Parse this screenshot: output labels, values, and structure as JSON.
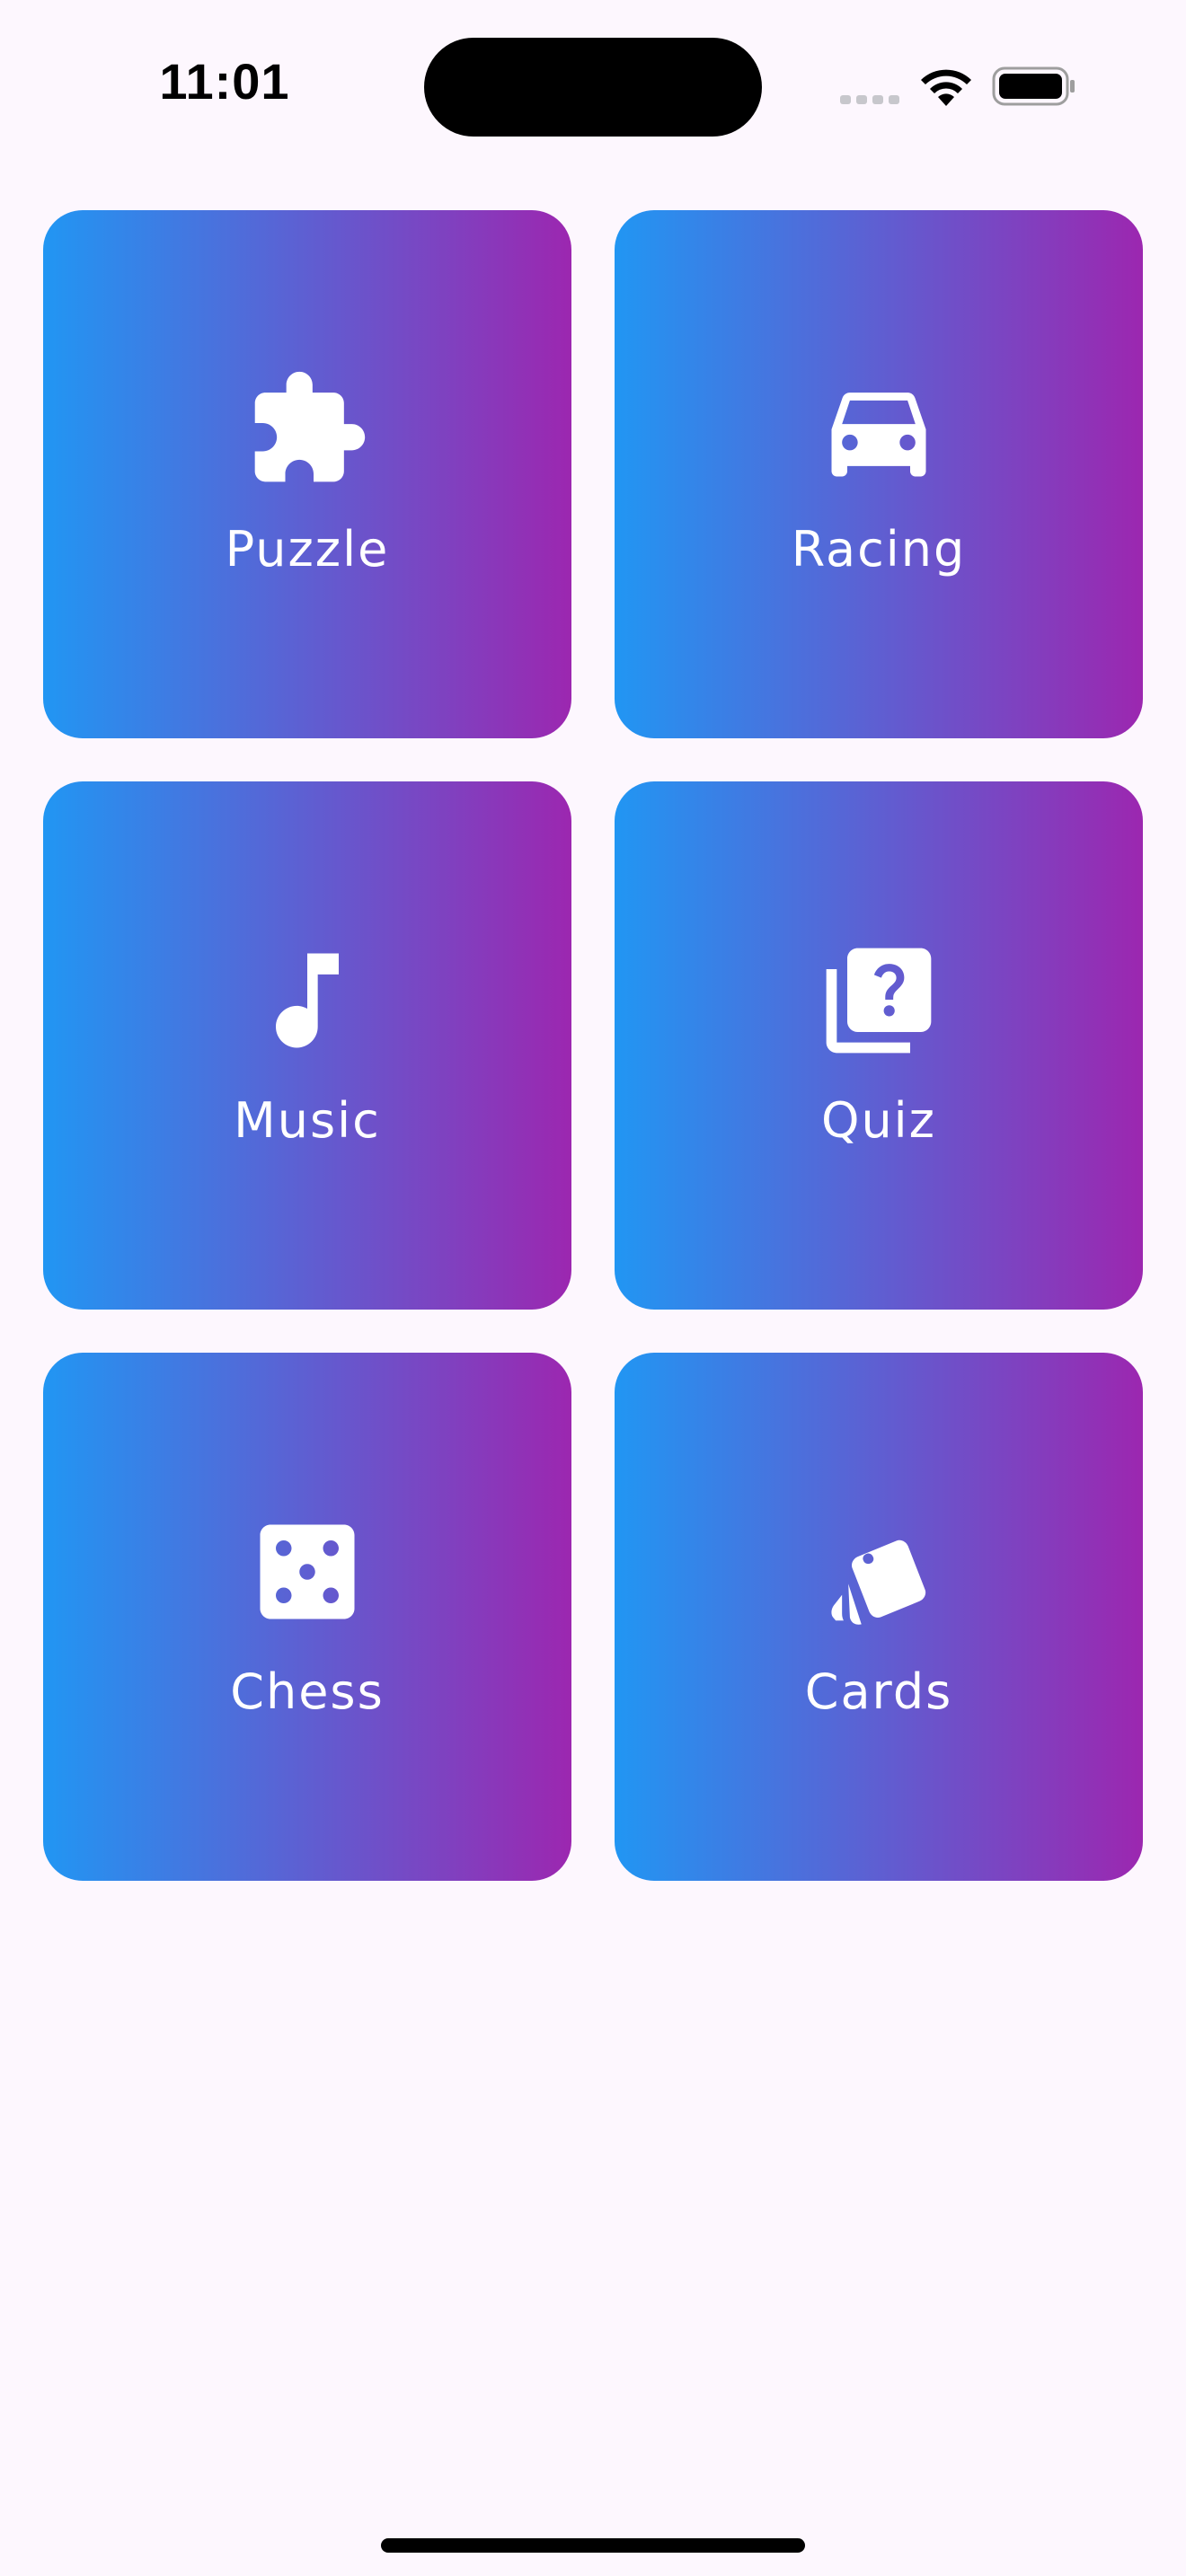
{
  "status_bar": {
    "time": "11:01",
    "icons": [
      "signal-icon",
      "wifi-icon",
      "battery-icon"
    ]
  },
  "tiles": [
    {
      "label": "Puzzle",
      "icon": "puzzle-icon"
    },
    {
      "label": "Racing",
      "icon": "car-icon"
    },
    {
      "label": "Music",
      "icon": "music-note-icon"
    },
    {
      "label": "Quiz",
      "icon": "quiz-icon"
    },
    {
      "label": "Chess",
      "icon": "dice-icon"
    },
    {
      "label": "Cards",
      "icon": "cards-icon"
    }
  ],
  "colors": {
    "background": "#fdf7fe",
    "gradient_start": "#2196f3",
    "gradient_end": "#9c27b0",
    "text": "#ffffff"
  }
}
